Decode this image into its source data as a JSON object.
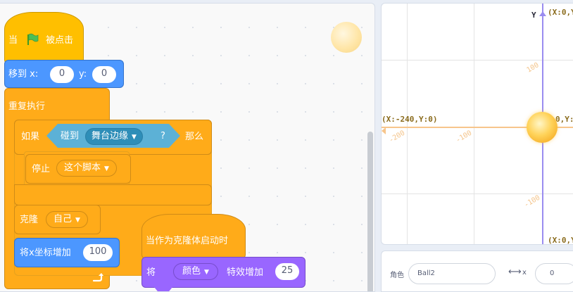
{
  "code": {
    "when_flag": {
      "prefix": "当",
      "suffix": "被点击"
    },
    "goto": {
      "label": "移到 x:",
      "y_label": "y:",
      "x_value": "0",
      "y_value": "0"
    },
    "forever": {
      "label": "重复执行"
    },
    "if_block": {
      "if_label": "如果",
      "then_label": "那么"
    },
    "touching": {
      "label": "碰到",
      "target": "舞台边缘",
      "qmark": "?"
    },
    "stop": {
      "label": "停止",
      "option": "这个脚本"
    },
    "clone": {
      "label": "克隆",
      "target": "自己"
    },
    "change_x": {
      "label": "将x坐标增加",
      "value": "100"
    },
    "clone_hat": {
      "label": "当作为克隆体启动时"
    },
    "effect": {
      "prefix": "将",
      "effect_name": "颜色",
      "suffix": "特效增加",
      "value": "25"
    }
  },
  "stage": {
    "axis_y_label": "Y",
    "top_coord": "(X:0,Y:",
    "left_coord": "(X:-240,Y:0)",
    "right_coord": "0,Y:",
    "bottom_coord": "(X:0,Y:",
    "ticks": {
      "y_pos": "100",
      "y_neg": "-100",
      "x_neg_200": "-200",
      "x_neg_100": "-100"
    }
  },
  "sprite_info": {
    "sprite_label": "角色",
    "sprite_name": "Ball2",
    "x_label": "x",
    "x_value": "0"
  },
  "colors": {
    "event": "#ffbf00",
    "motion": "#4c97ff",
    "control": "#ffab19",
    "sensing": "#5cb1d6",
    "looks": "#9966ff",
    "axis_line": "#9a8cf0",
    "stage_coord": "#8a6b1c"
  }
}
